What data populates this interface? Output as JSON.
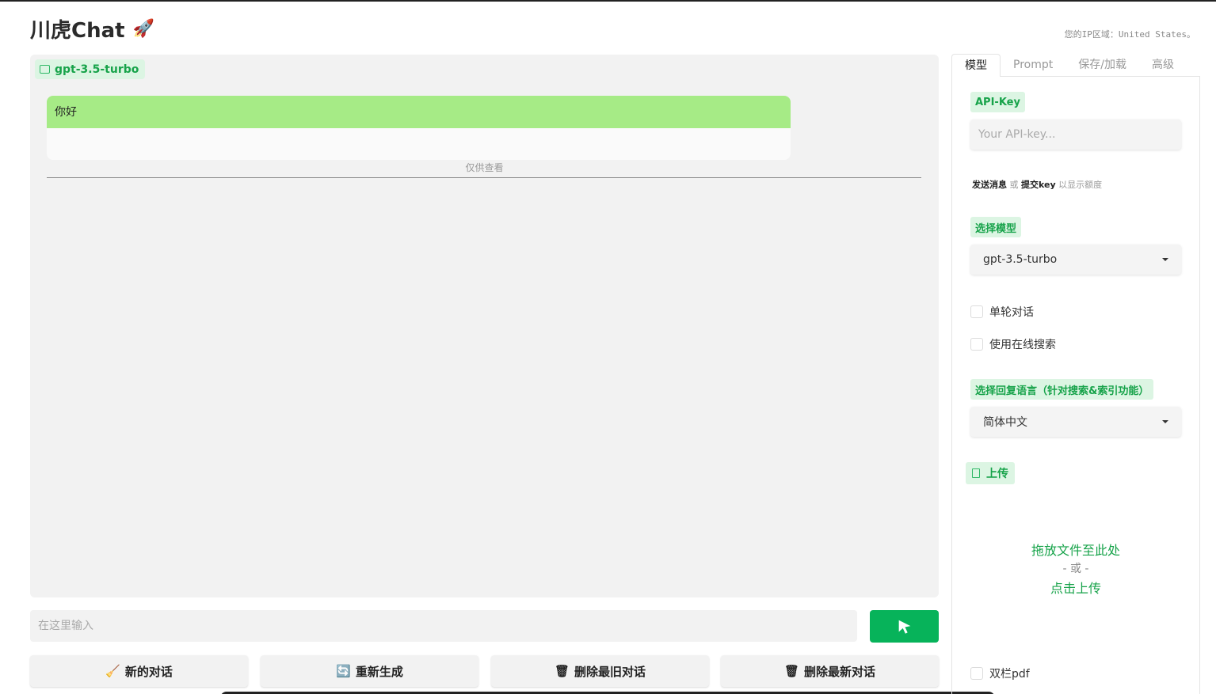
{
  "header": {
    "title": "川虎Chat",
    "rocket_glyph": "🚀",
    "ip_info": "您的IP区域：United States。"
  },
  "chat": {
    "model_badge": "gpt-3.5-turbo",
    "messages": [
      {
        "role": "user",
        "text": "你好"
      },
      {
        "role": "assistant",
        "text": ""
      }
    ],
    "view_only_label": "仅供查看",
    "input_placeholder": "在这里输入"
  },
  "actions": [
    {
      "label": "新的对话",
      "icon": "broom-icon",
      "glyph": "🧹"
    },
    {
      "label": "重新生成",
      "icon": "refresh-icon",
      "glyph": "🔄"
    },
    {
      "label": "删除最旧对话",
      "icon": "trash-icon",
      "glyph": "🗑"
    },
    {
      "label": "删除最新对话",
      "icon": "trash-icon",
      "glyph": "🗑"
    }
  ],
  "sidebar": {
    "tabs": [
      "模型",
      "Prompt",
      "保存/加载",
      "高级"
    ],
    "active_tab": "模型",
    "api_key_label": "API-Key",
    "api_key_placeholder": "Your API-key...",
    "hint": {
      "part1": "发送消息",
      "part2": " 或 ",
      "part3": "提交key",
      "part4": " 以显示额度"
    },
    "model_select_label": "选择模型",
    "model_select_value": "gpt-3.5-turbo",
    "single_turn_label": "单轮对话",
    "online_search_label": "使用在线搜索",
    "language_label": "选择回复语言（针对搜索&索引功能）",
    "language_value": "简体中文",
    "upload_label": "上传",
    "drop_text": "拖放文件至此处",
    "drop_or": "- 或 -",
    "drop_click": "点击上传",
    "two_column_pdf_label": "双栏pdf"
  },
  "colors": {
    "accent": "#07b35a",
    "user_bubble": "#a6eb86",
    "badge_bg": "#dcf5e3",
    "badge_text": "#17a34a"
  }
}
